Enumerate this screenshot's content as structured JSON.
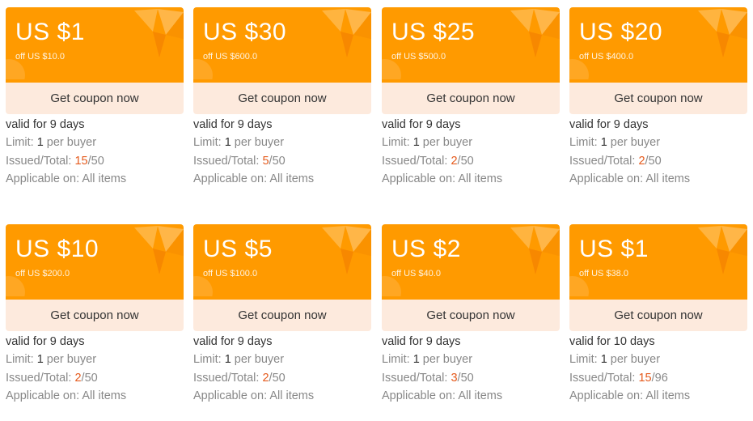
{
  "labels": {
    "limit_prefix": "Limit:",
    "limit_suffix": "per buyer",
    "issued_prefix": "Issued/Total:",
    "applicable_prefix": "Applicable on:",
    "button": "Get coupon now"
  },
  "colors": {
    "accent": "#ff9a00",
    "button_bg": "#fdeadd",
    "highlight": "#e55a1c"
  },
  "coupons": [
    {
      "amount": "US $1",
      "min_order": "off US $10.0",
      "validity": "valid for 9 days",
      "limit": "1",
      "issued": "15",
      "total": "50",
      "applicable": "All items"
    },
    {
      "amount": "US $30",
      "min_order": "off US $600.0",
      "validity": "valid for 9 days",
      "limit": "1",
      "issued": "5",
      "total": "50",
      "applicable": "All items"
    },
    {
      "amount": "US $25",
      "min_order": "off US $500.0",
      "validity": "valid for 9 days",
      "limit": "1",
      "issued": "2",
      "total": "50",
      "applicable": "All items"
    },
    {
      "amount": "US $20",
      "min_order": "off US $400.0",
      "validity": "valid for 9 days",
      "limit": "1",
      "issued": "2",
      "total": "50",
      "applicable": "All items"
    },
    {
      "amount": "US $10",
      "min_order": "off US $200.0",
      "validity": "valid for 9 days",
      "limit": "1",
      "issued": "2",
      "total": "50",
      "applicable": "All items"
    },
    {
      "amount": "US $5",
      "min_order": "off US $100.0",
      "validity": "valid for 9 days",
      "limit": "1",
      "issued": "2",
      "total": "50",
      "applicable": "All items"
    },
    {
      "amount": "US $2",
      "min_order": "off US $40.0",
      "validity": "valid for 9 days",
      "limit": "1",
      "issued": "3",
      "total": "50",
      "applicable": "All items"
    },
    {
      "amount": "US $1",
      "min_order": "off US $38.0",
      "validity": "valid for 10 days",
      "limit": "1",
      "issued": "15",
      "total": "96",
      "applicable": "All items"
    }
  ]
}
